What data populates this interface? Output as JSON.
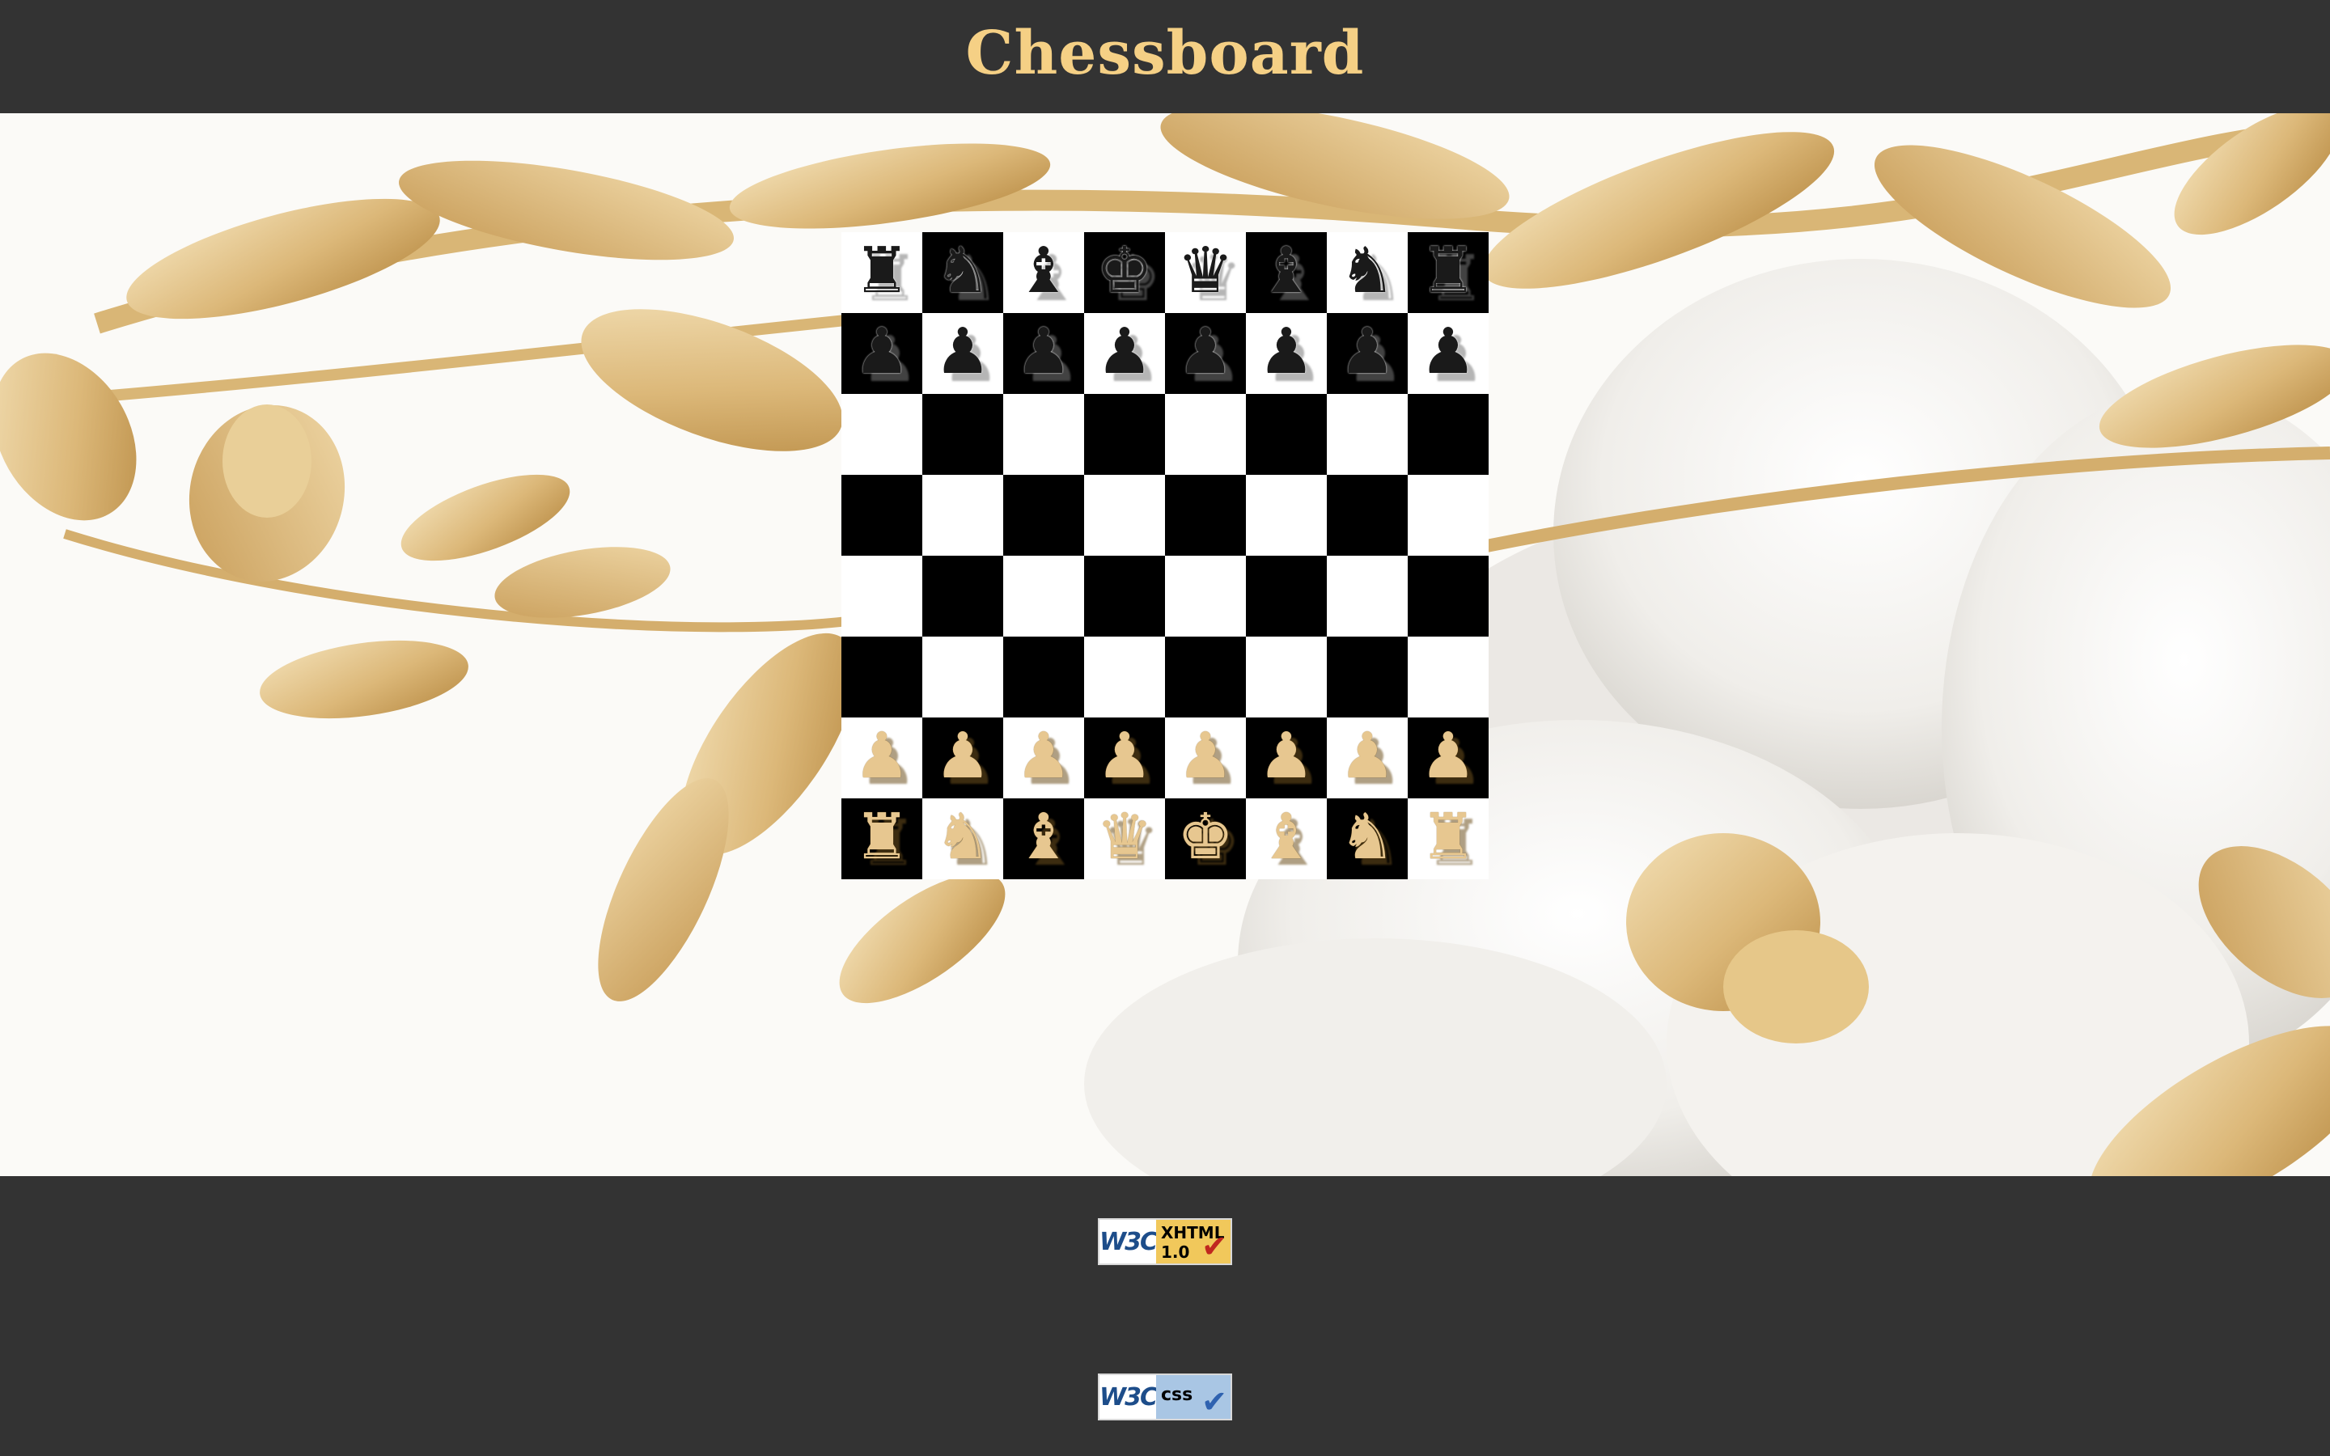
{
  "page": {
    "title": "Chessboard",
    "title_color": "#f5d085",
    "header_bg": "#333333",
    "footer_bg": "#333333"
  },
  "board": {
    "light_color": "#ffffff",
    "dark_color": "#000000",
    "first_square": "light",
    "rows": [
      [
        "bR",
        "bN",
        "bB",
        "bK",
        "bQ",
        "bB",
        "bN",
        "bR"
      ],
      [
        "bP",
        "bP",
        "bP",
        "bP",
        "bP",
        "bP",
        "bP",
        "bP"
      ],
      [
        "",
        "",
        "",
        "",
        "",
        "",
        "",
        ""
      ],
      [
        "",
        "",
        "",
        "",
        "",
        "",
        "",
        ""
      ],
      [
        "",
        "",
        "",
        "",
        "",
        "",
        "",
        ""
      ],
      [
        "",
        "",
        "",
        "",
        "",
        "",
        "",
        ""
      ],
      [
        "wP",
        "wP",
        "wP",
        "wP",
        "wP",
        "wP",
        "wP",
        "wP"
      ],
      [
        "wR",
        "wN",
        "wB",
        "wQ",
        "wK",
        "wB",
        "wN",
        "wR"
      ]
    ],
    "piece_glyphs": {
      "K": "♚",
      "Q": "♛",
      "R": "♜",
      "B": "♝",
      "N": "♞",
      "P": "♟"
    },
    "piece_names": {
      "K": "king",
      "Q": "queen",
      "R": "rook",
      "B": "bishop",
      "N": "knight",
      "P": "pawn"
    }
  },
  "footer": {
    "badges": [
      {
        "id": "xhtml",
        "logo": "W3C",
        "line1": "XHTML",
        "line2": "1.0",
        "check_color": "#c0271f",
        "icon": "checkmark-icon"
      },
      {
        "id": "css",
        "logo": "W3C",
        "line1": "css",
        "line2": "",
        "check_color": "#2f62b0",
        "icon": "checkmark-icon"
      }
    ]
  }
}
